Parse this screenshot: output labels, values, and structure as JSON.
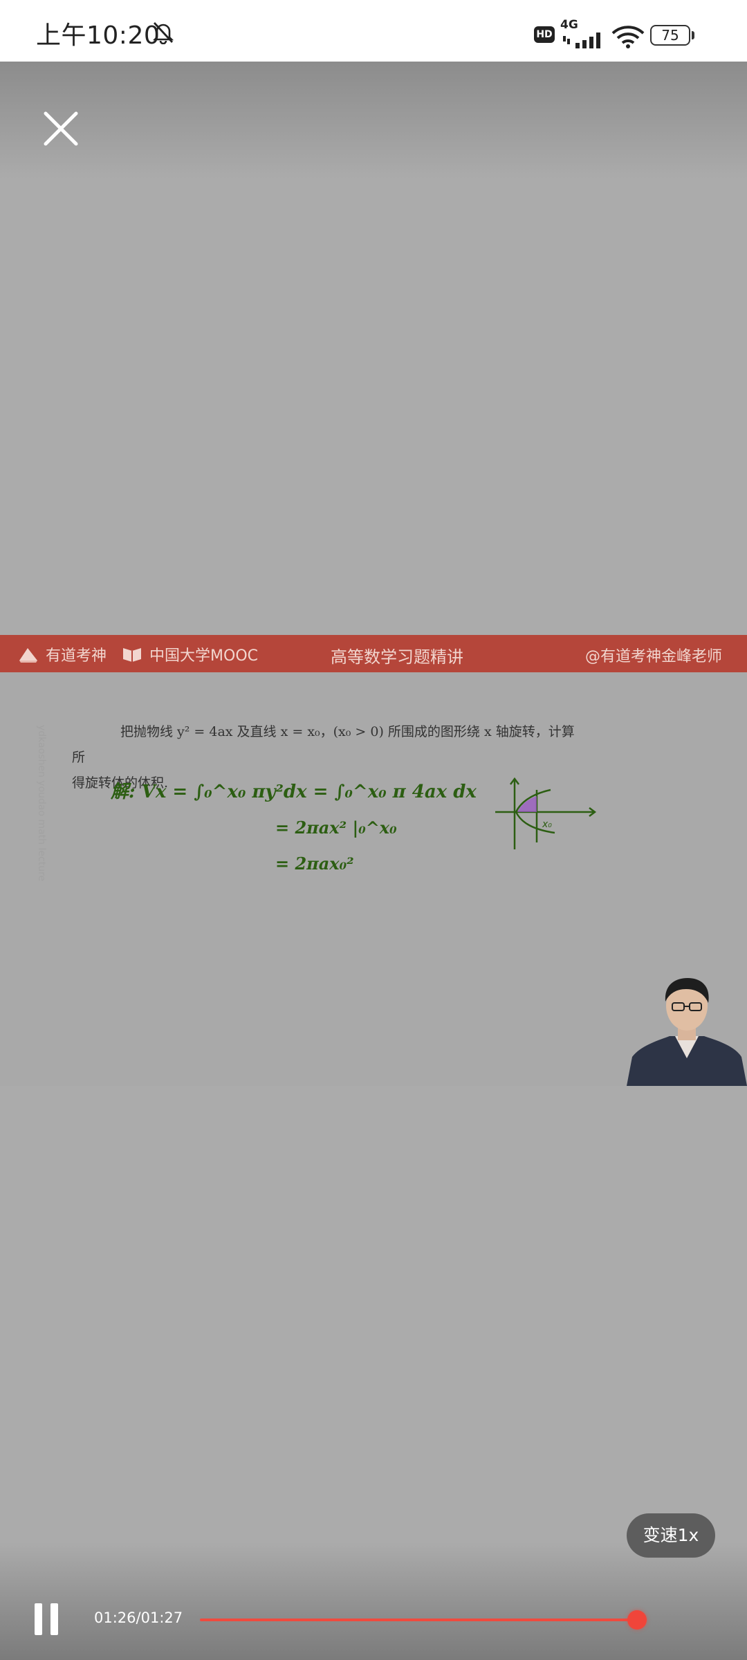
{
  "status_bar": {
    "time": "上午10:20",
    "hd_label": "HD",
    "network_label": "4G",
    "battery_level": "75"
  },
  "video": {
    "banner": {
      "brand_1": "有道考神",
      "brand_2": "中国大学MOOC",
      "course_title": "高等数学习题精讲",
      "teacher_handle": "@有道考神金峰老师"
    },
    "problem_line_1": "把抛物线 y² = 4ax 及直线 x = x₀，(x₀ > 0) 所围成的图形绕 x 轴旋转，计算所",
    "problem_line_2": "得旋转体的体积.",
    "handwriting": {
      "line_1": "解:  Vx = ∫₀^x₀ πy²dx = ∫₀^x₀ π 4ax dx",
      "line_2": "= 2πax² |₀^x₀",
      "line_3": "= 2πax₀²",
      "sketch_label": "x₀"
    }
  },
  "controls": {
    "speed_label": "变速1x",
    "time_display": "01:26/01:27",
    "progress_fraction": 0.988
  },
  "colors": {
    "banner": "#b5463a",
    "progress": "#f04a3e",
    "handwriting": "#2c5e12"
  },
  "icons": {
    "close": "close-icon",
    "mute": "bell-off-icon",
    "pause": "pause-icon"
  }
}
